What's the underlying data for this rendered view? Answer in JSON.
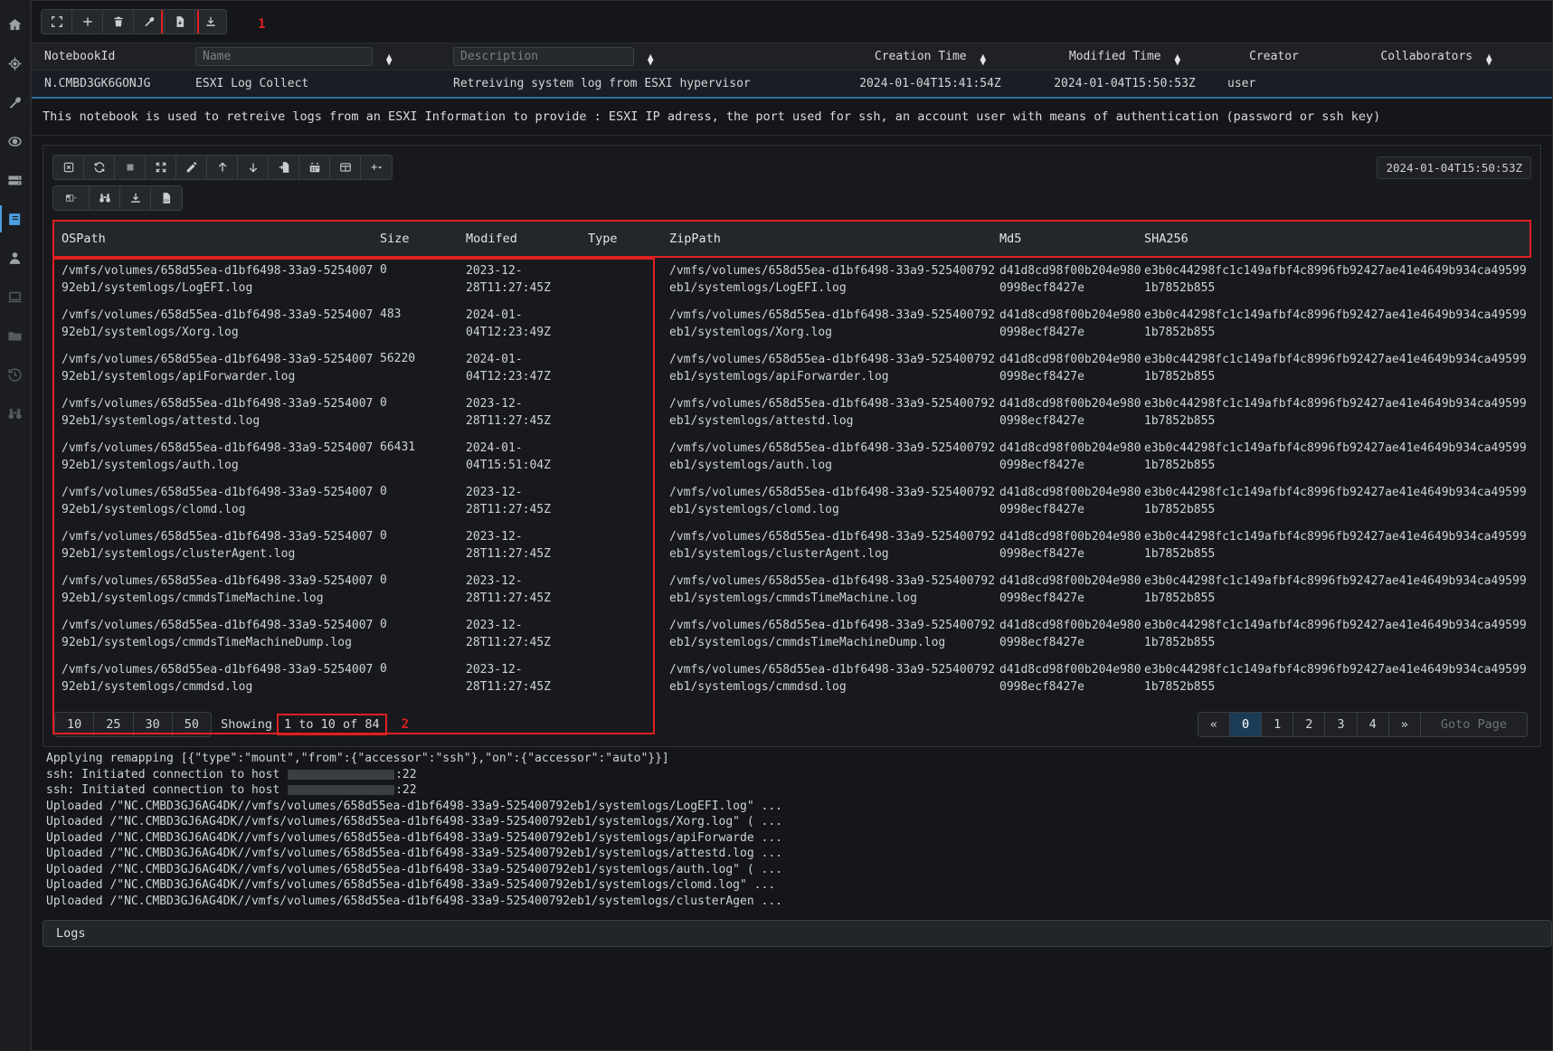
{
  "sidebar": {
    "items": [
      {
        "icon": "home-icon",
        "name": "sidebar-item-home",
        "active": false
      },
      {
        "icon": "target-icon",
        "name": "sidebar-item-hunt",
        "active": false
      },
      {
        "icon": "wrench-icon",
        "name": "sidebar-item-tools",
        "active": false
      },
      {
        "icon": "eye-icon",
        "name": "sidebar-item-monitor",
        "active": false
      },
      {
        "icon": "server-icon",
        "name": "sidebar-item-server",
        "active": false
      },
      {
        "icon": "notebook-icon",
        "name": "sidebar-item-notebooks",
        "active": true
      },
      {
        "icon": "user-icon",
        "name": "sidebar-item-users",
        "active": false
      },
      {
        "icon": "laptop-icon",
        "name": "sidebar-item-clients",
        "active": false
      },
      {
        "icon": "folder-icon",
        "name": "sidebar-item-files",
        "active": false
      },
      {
        "icon": "history-icon",
        "name": "sidebar-item-history",
        "active": false
      },
      {
        "icon": "binoculars-icon",
        "name": "sidebar-item-search",
        "active": false
      }
    ]
  },
  "top_toolbar": {
    "buttons": [
      {
        "icon": "fullscreen-icon",
        "name": "fullscreen-button",
        "highlighted": false
      },
      {
        "icon": "plus-icon",
        "name": "new-notebook-button",
        "highlighted": false
      },
      {
        "icon": "trash-icon",
        "name": "delete-notebook-button",
        "highlighted": false
      },
      {
        "icon": "wrench-icon",
        "name": "edit-notebook-button",
        "highlighted": false
      },
      {
        "icon": "file-export-icon",
        "name": "export-notebook-button",
        "highlighted": true
      },
      {
        "icon": "download-icon",
        "name": "download-notebook-button",
        "highlighted": false
      }
    ],
    "annotation_1": "1"
  },
  "notebook_table": {
    "headers": {
      "notebook_id": "NotebookId",
      "name_placeholder": "Name",
      "description_placeholder": "Description",
      "creation_time": "Creation Time",
      "modified_time": "Modified Time",
      "creator": "Creator",
      "collaborators": "Collaborators"
    },
    "row": {
      "notebook_id": "N.CMBD3GK6GONJG",
      "name": "ESXI Log Collect",
      "description": "Retreiving system log from ESXI hypervisor",
      "creation_time": "2024-01-04T15:41:54Z",
      "modified_time": "2024-01-04T15:50:53Z",
      "creator": "user",
      "collaborators": ""
    }
  },
  "notebook_description": "This notebook is used to retreive logs from an ESXI Information to provide : ESXI IP adress, the port used for ssh, an account user with means of authentication (password or ssh key)",
  "cell_toolbar": {
    "buttons": [
      {
        "icon": "cancel-box-icon",
        "name": "cancel-cell-button"
      },
      {
        "icon": "refresh-icon",
        "name": "recalculate-cell-button"
      },
      {
        "icon": "stop-icon",
        "name": "stop-cell-button"
      },
      {
        "icon": "collapse-icon",
        "name": "collapse-cell-button"
      },
      {
        "icon": "pencil-icon",
        "name": "edit-cell-button"
      },
      {
        "icon": "arrow-up-icon",
        "name": "move-cell-up-button"
      },
      {
        "icon": "arrow-down-icon",
        "name": "move-cell-down-button"
      },
      {
        "icon": "file-import-icon",
        "name": "paste-cell-button"
      },
      {
        "icon": "calendar-icon",
        "name": "cell-timeline-button"
      },
      {
        "icon": "table-icon",
        "name": "add-table-button"
      },
      {
        "icon": "plus-dropdown-icon",
        "name": "add-cell-dropdown-button"
      }
    ],
    "timestamp": "2024-01-04T15:50:53Z"
  },
  "table_toolbar": {
    "buttons": [
      {
        "icon": "columns-dropdown-icon",
        "name": "column-selector-button"
      },
      {
        "icon": "binoculars-icon",
        "name": "table-search-button"
      },
      {
        "icon": "download-icon",
        "name": "download-json-button"
      },
      {
        "icon": "csv-file-icon",
        "name": "download-csv-button"
      }
    ]
  },
  "data_table": {
    "columns": [
      "OSPath",
      "Size",
      "Modifed",
      "Type",
      "ZipPath",
      "Md5",
      "SHA256"
    ],
    "md5_common": "d41d8cd98f00b204e9800998ecf8427e",
    "sha_common": "e3b0c44298fc1c149afbf4c8996fb92427ae41e4649b934ca495991b7852b855",
    "rows": [
      {
        "ospath": "/vmfs/volumes/658d55ea-d1bf6498-33a9-525400792eb1/systemlogs/LogEFI.log",
        "size": "0",
        "modified": "2023-12-28T11:27:45Z",
        "type": "",
        "zippath": "/vmfs/volumes/658d55ea-d1bf6498-33a9-525400792eb1/systemlogs/LogEFI.log"
      },
      {
        "ospath": "/vmfs/volumes/658d55ea-d1bf6498-33a9-525400792eb1/systemlogs/Xorg.log",
        "size": "483",
        "modified": "2024-01-04T12:23:49Z",
        "type": "",
        "zippath": "/vmfs/volumes/658d55ea-d1bf6498-33a9-525400792eb1/systemlogs/Xorg.log"
      },
      {
        "ospath": "/vmfs/volumes/658d55ea-d1bf6498-33a9-525400792eb1/systemlogs/apiForwarder.log",
        "size": "56220",
        "modified": "2024-01-04T12:23:47Z",
        "type": "",
        "zippath": "/vmfs/volumes/658d55ea-d1bf6498-33a9-525400792eb1/systemlogs/apiForwarder.log"
      },
      {
        "ospath": "/vmfs/volumes/658d55ea-d1bf6498-33a9-525400792eb1/systemlogs/attestd.log",
        "size": "0",
        "modified": "2023-12-28T11:27:45Z",
        "type": "",
        "zippath": "/vmfs/volumes/658d55ea-d1bf6498-33a9-525400792eb1/systemlogs/attestd.log"
      },
      {
        "ospath": "/vmfs/volumes/658d55ea-d1bf6498-33a9-525400792eb1/systemlogs/auth.log",
        "size": "66431",
        "modified": "2024-01-04T15:51:04Z",
        "type": "",
        "zippath": "/vmfs/volumes/658d55ea-d1bf6498-33a9-525400792eb1/systemlogs/auth.log"
      },
      {
        "ospath": "/vmfs/volumes/658d55ea-d1bf6498-33a9-525400792eb1/systemlogs/clomd.log",
        "size": "0",
        "modified": "2023-12-28T11:27:45Z",
        "type": "",
        "zippath": "/vmfs/volumes/658d55ea-d1bf6498-33a9-525400792eb1/systemlogs/clomd.log"
      },
      {
        "ospath": "/vmfs/volumes/658d55ea-d1bf6498-33a9-525400792eb1/systemlogs/clusterAgent.log",
        "size": "0",
        "modified": "2023-12-28T11:27:45Z",
        "type": "",
        "zippath": "/vmfs/volumes/658d55ea-d1bf6498-33a9-525400792eb1/systemlogs/clusterAgent.log"
      },
      {
        "ospath": "/vmfs/volumes/658d55ea-d1bf6498-33a9-525400792eb1/systemlogs/cmmdsTimeMachine.log",
        "size": "0",
        "modified": "2023-12-28T11:27:45Z",
        "type": "",
        "zippath": "/vmfs/volumes/658d55ea-d1bf6498-33a9-525400792eb1/systemlogs/cmmdsTimeMachine.log"
      },
      {
        "ospath": "/vmfs/volumes/658d55ea-d1bf6498-33a9-525400792eb1/systemlogs/cmmdsTimeMachineDump.log",
        "size": "0",
        "modified": "2023-12-28T11:27:45Z",
        "type": "",
        "zippath": "/vmfs/volumes/658d55ea-d1bf6498-33a9-525400792eb1/systemlogs/cmmdsTimeMachineDump.log"
      },
      {
        "ospath": "/vmfs/volumes/658d55ea-d1bf6498-33a9-525400792eb1/systemlogs/cmmdsd.log",
        "size": "0",
        "modified": "2023-12-28T11:27:45Z",
        "type": "",
        "zippath": "/vmfs/volumes/658d55ea-d1bf6498-33a9-525400792eb1/systemlogs/cmmdsd.log"
      }
    ]
  },
  "pagination": {
    "page_sizes": [
      "10",
      "25",
      "30",
      "50"
    ],
    "showing_label": "Showing",
    "showing_range": "1 to 10 of 84",
    "annotation_2": "2",
    "prev": "«",
    "pages": [
      "0",
      "1",
      "2",
      "3",
      "4"
    ],
    "current_page": "0",
    "next": "»",
    "goto_placeholder": "Goto Page"
  },
  "console": {
    "lines": [
      "Applying remapping [{\"type\":\"mount\",\"from\":{\"accessor\":\"ssh\"},\"on\":{\"accessor\":\"auto\"}}]",
      "Uploaded /\"NC.CMBD3GJ6AG4DK//vmfs/volumes/658d55ea-d1bf6498-33a9-525400792eb1/systemlogs/LogEFI.log\" ...",
      "Uploaded /\"NC.CMBD3GJ6AG4DK//vmfs/volumes/658d55ea-d1bf6498-33a9-525400792eb1/systemlogs/Xorg.log\" ( ...",
      "Uploaded /\"NC.CMBD3GJ6AG4DK//vmfs/volumes/658d55ea-d1bf6498-33a9-525400792eb1/systemlogs/apiForwarde ...",
      "Uploaded /\"NC.CMBD3GJ6AG4DK//vmfs/volumes/658d55ea-d1bf6498-33a9-525400792eb1/systemlogs/attestd.log ...",
      "Uploaded /\"NC.CMBD3GJ6AG4DK//vmfs/volumes/658d55ea-d1bf6498-33a9-525400792eb1/systemlogs/auth.log\" ( ...",
      "Uploaded /\"NC.CMBD3GJ6AG4DK//vmfs/volumes/658d55ea-d1bf6498-33a9-525400792eb1/systemlogs/clomd.log\" ...",
      "Uploaded /\"NC.CMBD3GJ6AG4DK//vmfs/volumes/658d55ea-d1bf6498-33a9-525400792eb1/systemlogs/clusterAgen ..."
    ],
    "ssh_prefix": "ssh: Initiated connection to host",
    "ssh_suffix": ":22",
    "logs_button": "Logs"
  }
}
